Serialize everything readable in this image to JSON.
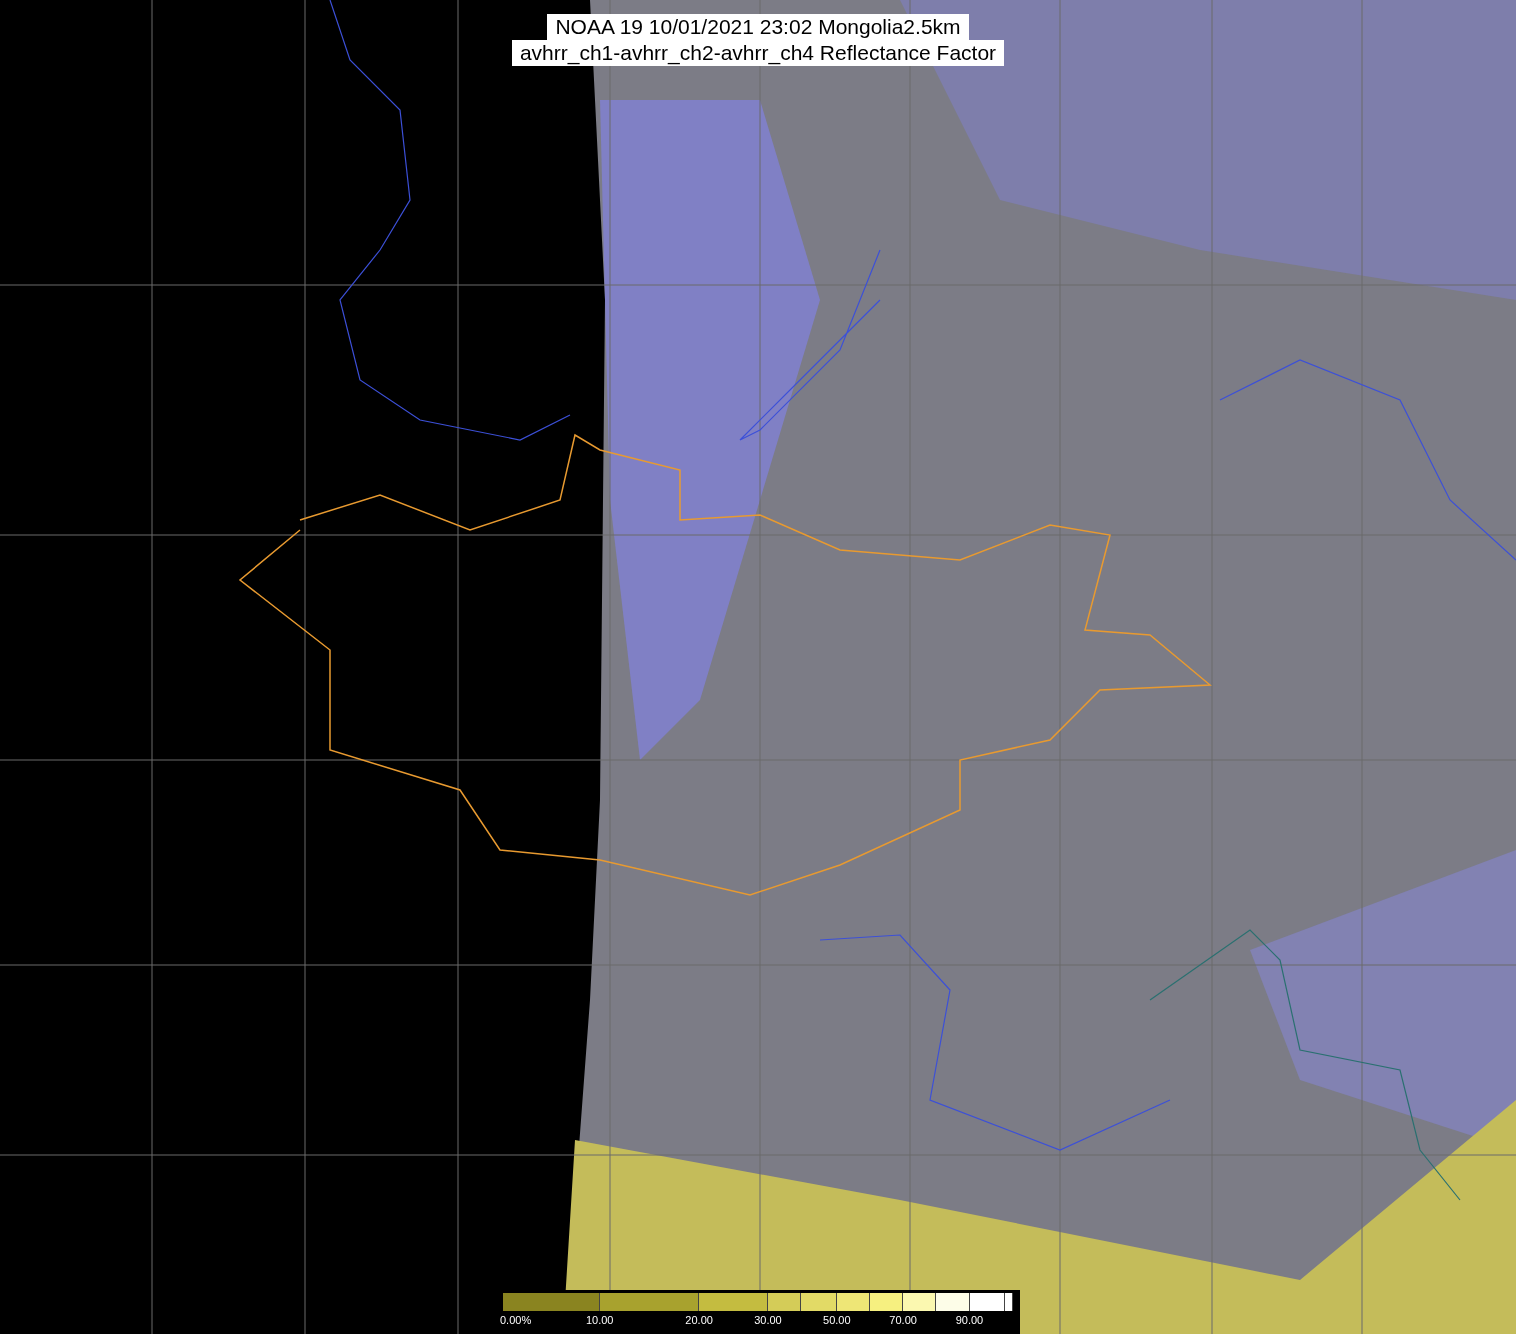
{
  "title": {
    "lines": [
      "NOAA 19 10/01/2021 23:02 Mongolia2.5km",
      "avhrr_ch1-avhrr_ch2-avhrr_ch4 Reflectance Factor"
    ]
  },
  "colorbar": {
    "ticks": [
      {
        "label": "0.00%"
      },
      {
        "label": "10.00"
      },
      {
        "label": "20.00"
      },
      {
        "label": "30.00"
      },
      {
        "label": "50.00"
      },
      {
        "label": "70.00"
      },
      {
        "label": "90.00"
      }
    ]
  }
}
